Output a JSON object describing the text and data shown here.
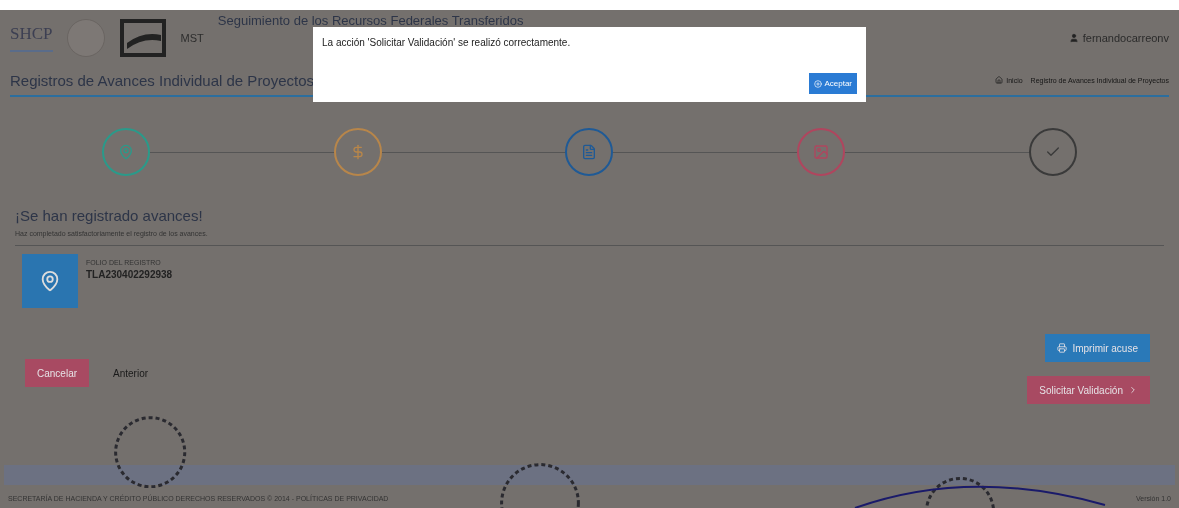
{
  "header": {
    "agency": "SHCP",
    "app_short": "MST",
    "app_title": "Seguimiento de los Recursos Federales Transferidos",
    "user": "fernandocarreonv"
  },
  "title_bar": {
    "title": "Registros de Avances Individual de Proyectos",
    "breadcrumbs": [
      "Inicio",
      "Registro de Avances Individual de Proyectos"
    ]
  },
  "steps": [
    {
      "kind": "location",
      "color": "#2a9a8a"
    },
    {
      "kind": "money",
      "color": "#b8864a"
    },
    {
      "kind": "document",
      "color": "#1f5a96"
    },
    {
      "kind": "image",
      "color": "#b0455e"
    },
    {
      "kind": "check",
      "color": "#3a3a3a"
    }
  ],
  "result": {
    "heading": "¡Se han registrado avances!",
    "message": "Haz completado satisfactoriamente el registro de los avances.",
    "folio_label": "FOLIO DEL REGISTRO",
    "folio": "TLA230402292938"
  },
  "actions": {
    "left": [
      {
        "label": "Cancelar",
        "kind": "danger"
      },
      {
        "label": "Anterior",
        "kind": "link"
      }
    ],
    "right": [
      {
        "label": "Imprimir acuse",
        "kind": "primary"
      },
      {
        "label": "Solicitar Validación",
        "kind": "danger"
      }
    ]
  },
  "footer": {
    "text": "SECRETARÍA DE HACIENDA Y CRÉDITO PÚBLICO DERECHOS RESERVADOS © 2014 - POLÍTICAS DE PRIVACIDAD",
    "version": "Versión 1.0"
  },
  "dialog": {
    "message": "La acción 'Solicitar Validación' se realizó correctamente.",
    "button": "Aceptar"
  }
}
